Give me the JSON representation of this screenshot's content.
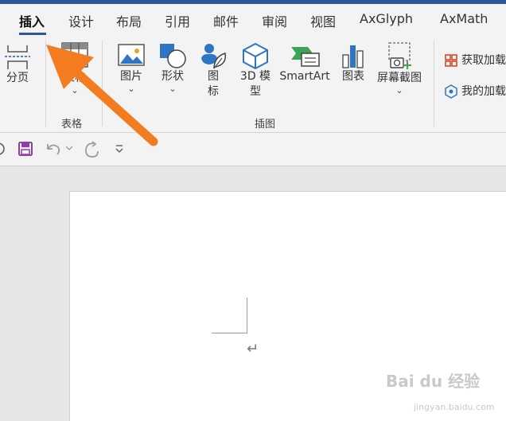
{
  "tabs": [
    "插入",
    "设计",
    "布局",
    "引用",
    "邮件",
    "审阅",
    "视图",
    "AxGlyph",
    "AxMath"
  ],
  "ribbon": {
    "page_break": "分页",
    "table": "表格",
    "pictures": "图片",
    "shapes": "形状",
    "icons_line1": "图",
    "icons_line2": "标",
    "model3d_line1": "3D 模",
    "model3d_line2": "型",
    "smartart": "SmartArt",
    "chart": "图表",
    "screenshot": "屏幕截图",
    "group_tables": "表格",
    "group_illustrations": "插图",
    "get_addins": "获取加载",
    "my_addins": "我的加载",
    "chevron": "⌄"
  },
  "colors": {
    "accent": "#2b579a",
    "arrow": "#f47c20",
    "save_purple": "#8e3fa8",
    "smartart_green": "#3aa655"
  },
  "watermark": {
    "text": "Bai du 经验",
    "sub": "jingyan.baidu.com"
  }
}
